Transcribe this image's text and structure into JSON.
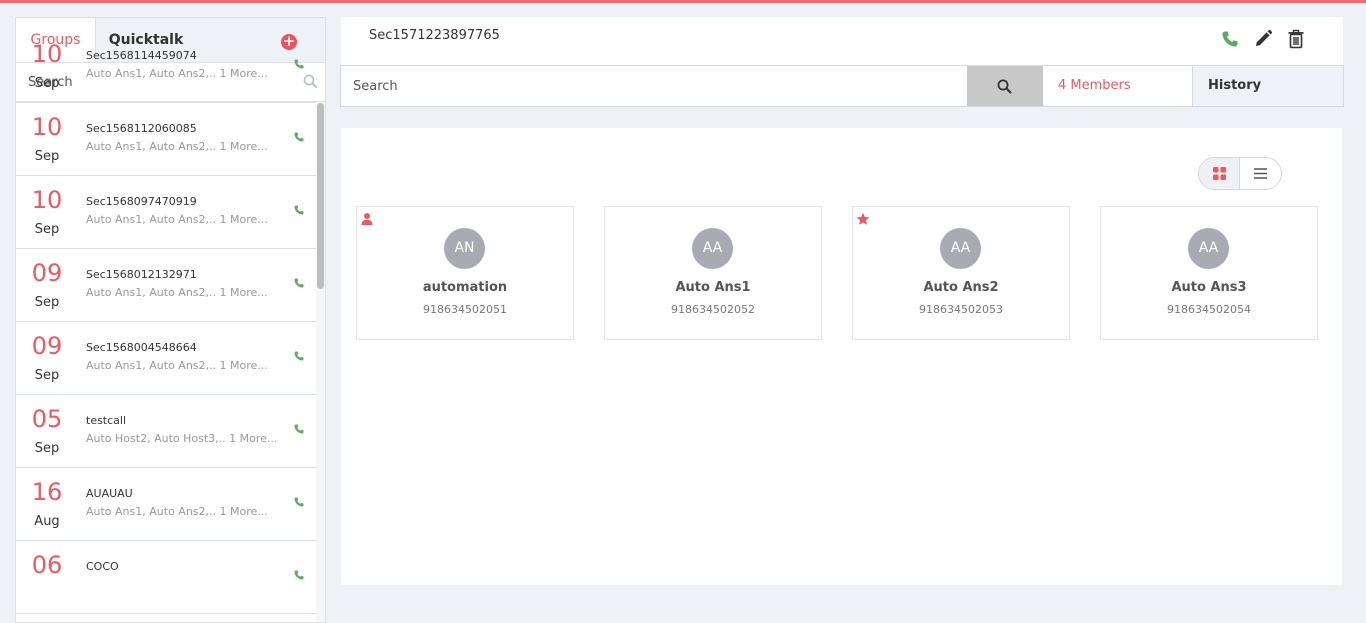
{
  "sidebar": {
    "tabs": {
      "groups": "Groups",
      "quicktalk": "Quicktalk"
    },
    "add_label": "+",
    "search_placeholder": "Search",
    "items": [
      {
        "day": "10",
        "month": "Sep",
        "title": "Sec1568114459074",
        "members": "Auto Ans1, Auto Ans2,.. 1 More..."
      },
      {
        "day": "10",
        "month": "Sep",
        "title": "Sec1568112060085",
        "members": "Auto Ans1, Auto Ans2,.. 1 More..."
      },
      {
        "day": "10",
        "month": "Sep",
        "title": "Sec1568097470919",
        "members": "Auto Ans1, Auto Ans2,.. 1 More..."
      },
      {
        "day": "09",
        "month": "Sep",
        "title": "Sec1568012132971",
        "members": "Auto Ans1, Auto Ans2,.. 1 More..."
      },
      {
        "day": "09",
        "month": "Sep",
        "title": "Sec1568004548664",
        "members": "Auto Ans1, Auto Ans2,.. 1 More..."
      },
      {
        "day": "05",
        "month": "Sep",
        "title": "testcall",
        "members": "Auto Host2, Auto Host3,.. 1 More..."
      },
      {
        "day": "16",
        "month": "Aug",
        "title": "AUAUAU",
        "members": "Auto Ans1, Auto Ans2,.. 1 More..."
      },
      {
        "day": "06",
        "month": "",
        "title": "COCO",
        "members": ""
      }
    ]
  },
  "header": {
    "group_name": "Sec1571223897765"
  },
  "member_bar": {
    "search_placeholder": "Search",
    "members_label": "4 Members",
    "history_label": "History"
  },
  "members": [
    {
      "initials": "AN",
      "name": "automation",
      "phone": "918634502051",
      "badge": "person-icon"
    },
    {
      "initials": "AA",
      "name": "Auto Ans1",
      "phone": "918634502052",
      "badge": ""
    },
    {
      "initials": "AA",
      "name": "Auto Ans2",
      "phone": "918634502053",
      "badge": "star-icon"
    },
    {
      "initials": "AA",
      "name": "Auto Ans3",
      "phone": "918634502054",
      "badge": ""
    }
  ],
  "colors": {
    "accent": "#f0585f",
    "call_green": "#5cb85c",
    "avatar_grey": "#a8acb2"
  }
}
